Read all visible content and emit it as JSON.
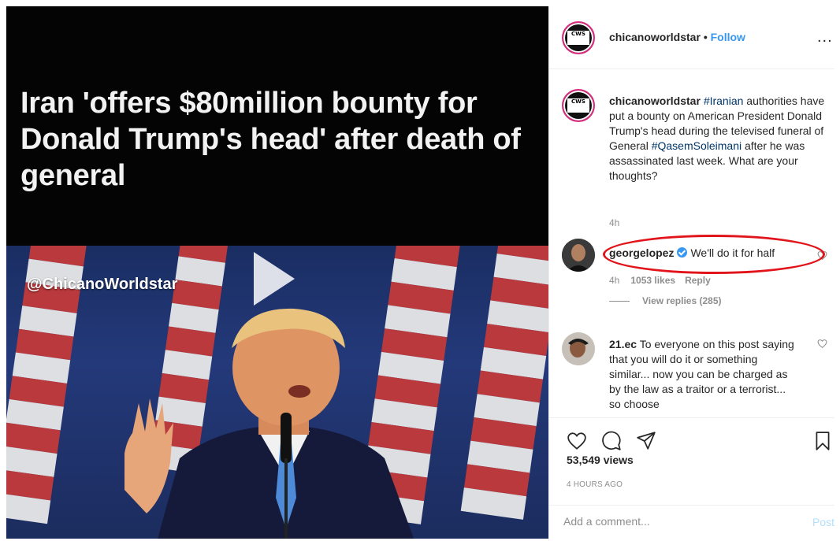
{
  "media": {
    "headline": "Iran 'offers $80million bounty for Donald Trump's head' after death of general",
    "watermark": "@ChicanoWorldstar",
    "play_icon": "play-icon"
  },
  "header": {
    "username": "chicanoworldstar",
    "separator": "•",
    "follow_label": "Follow",
    "more_label": "..."
  },
  "caption": {
    "username": "chicanoworldstar",
    "hashtag1": "#Iranian",
    "text_part1": " authorities have put a bounty on American President Donald Trump's head during the televised funeral of General ",
    "hashtag2": "#QasemSoleimani",
    "text_part2": " after he was assassinated last week. What are your thoughts?",
    "time": "4h"
  },
  "comments": [
    {
      "username": "georgelopez",
      "verified": true,
      "text": "We'll do it for half",
      "time": "4h",
      "likes": "1053 likes",
      "reply_label": "Reply",
      "view_replies": "View replies (285)"
    },
    {
      "username": "21.ec",
      "text": "To everyone on this post saying that you will do it or something similar... now you can be charged as by the law as a traitor or a terrorist... so choose"
    }
  ],
  "stats": {
    "views": "53,549 views",
    "posted": "4 HOURS AGO"
  },
  "add_comment": {
    "placeholder": "Add a comment...",
    "post_label": "Post"
  },
  "colors": {
    "link_blue": "#3897f0",
    "hashtag": "#003569",
    "highlight_red": "#e2141b",
    "post_disabled": "#b2dffc"
  }
}
